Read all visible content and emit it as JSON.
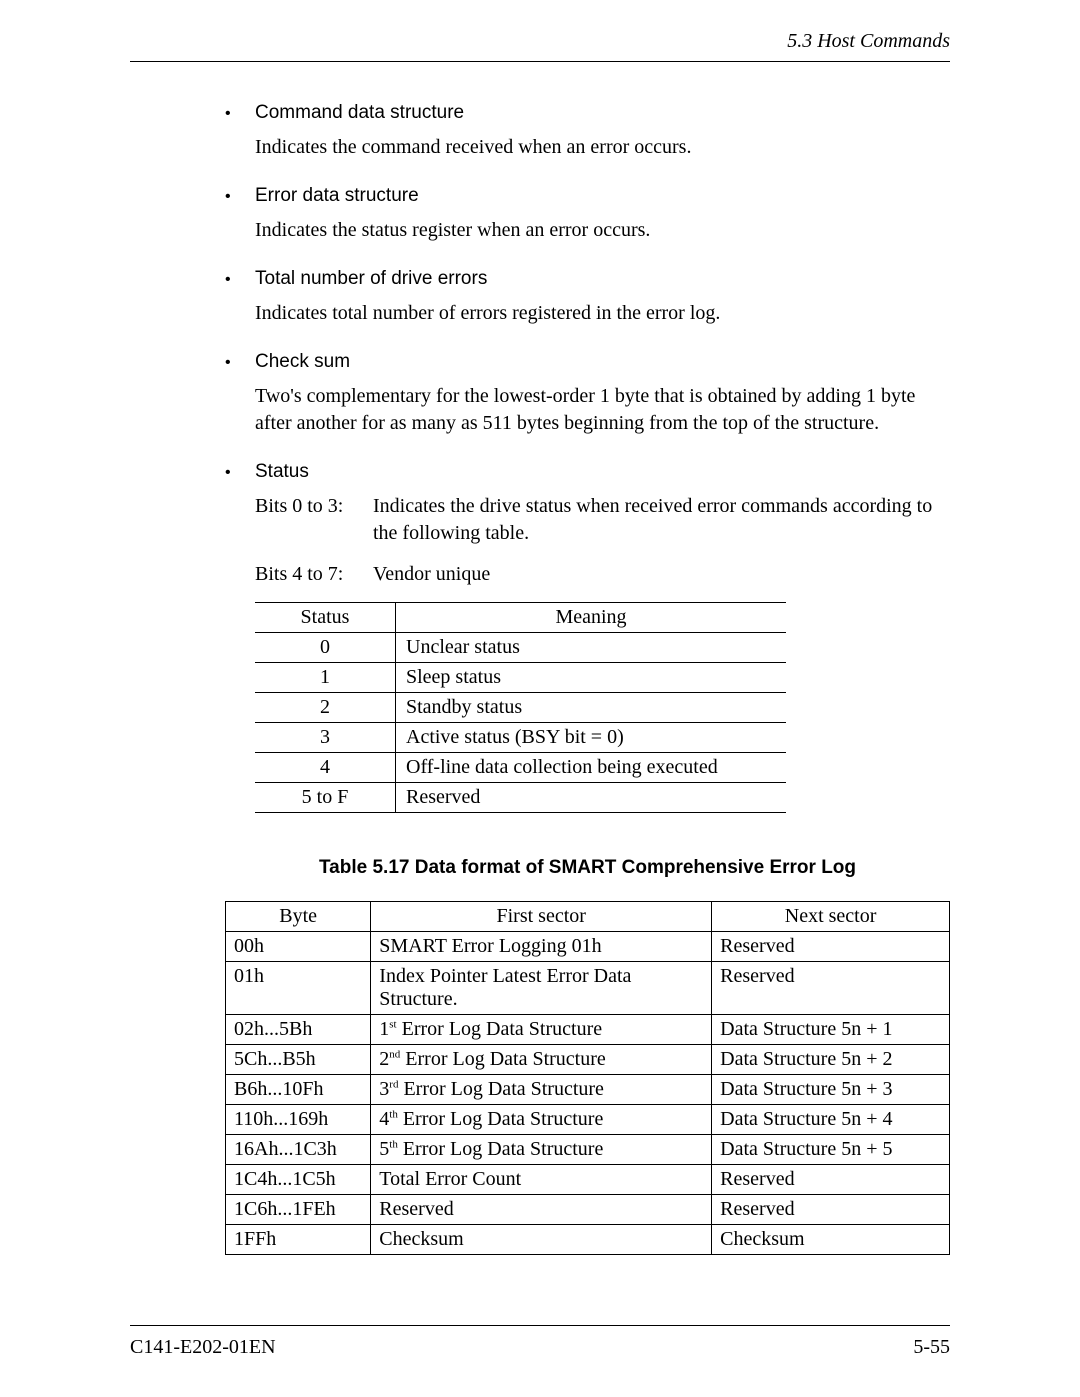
{
  "header": {
    "section": "5.3  Host Commands"
  },
  "bullets": [
    {
      "title": "Command data structure",
      "desc": "Indicates the command received when an error occurs."
    },
    {
      "title": "Error data structure",
      "desc": "Indicates the status register when an error occurs."
    },
    {
      "title": "Total number of drive errors",
      "desc": "Indicates total number of errors registered in the error log."
    },
    {
      "title": "Check sum",
      "desc": "Two's complementary for the lowest-order 1 byte that is obtained by adding 1 byte after another for as many as 511 bytes beginning from the top of the structure."
    },
    {
      "title": "Status"
    }
  ],
  "status_bits": {
    "row0_label": "Bits 0 to 3:",
    "row0_text": "Indicates the drive status when received error commands according to the following table.",
    "row1_label": "Bits 4 to 7:",
    "row1_text": "Vendor unique"
  },
  "status_table": {
    "headers": [
      "Status",
      "Meaning"
    ],
    "rows": [
      [
        "0",
        "Unclear status"
      ],
      [
        "1",
        "Sleep status"
      ],
      [
        "2",
        "Standby status"
      ],
      [
        "3",
        "Active status (BSY bit = 0)"
      ],
      [
        "4",
        "Off-line data collection being executed"
      ],
      [
        "5 to F",
        "Reserved"
      ]
    ]
  },
  "smart_caption": "Table 5.17  Data format of SMART Comprehensive Error Log",
  "smart_table": {
    "headers": [
      "Byte",
      "First sector",
      "Next sector"
    ],
    "rows": [
      {
        "c1": "00h",
        "c2": "SMART Error Logging 01h",
        "c3": "Reserved"
      },
      {
        "c1": "01h",
        "c2": "Index Pointer Latest Error Data Structure.",
        "c3": "Reserved"
      },
      {
        "c1": "02h...5Bh",
        "c2_pre": "1",
        "c2_ord": "st",
        "c2_post": " Error Log Data Structure",
        "c3": "Data Structure 5n + 1"
      },
      {
        "c1": "5Ch...B5h",
        "c2_pre": "2",
        "c2_ord": "nd",
        "c2_post": " Error Log Data Structure",
        "c3": "Data Structure 5n + 2"
      },
      {
        "c1": "B6h...10Fh",
        "c2_pre": "3",
        "c2_ord": "rd",
        "c2_post": " Error Log Data Structure",
        "c3": "Data Structure 5n + 3"
      },
      {
        "c1": "110h...169h",
        "c2_pre": "4",
        "c2_ord": "th",
        "c2_post": " Error Log Data Structure",
        "c3": "Data Structure 5n + 4"
      },
      {
        "c1": "16Ah...1C3h",
        "c2_pre": "5",
        "c2_ord": "th",
        "c2_post": " Error Log Data Structure",
        "c3": "Data Structure 5n + 5"
      },
      {
        "c1": "1C4h...1C5h",
        "c2": "Total Error Count",
        "c3": "Reserved"
      },
      {
        "c1": "1C6h...1FEh",
        "c2": "Reserved",
        "c3": "Reserved"
      },
      {
        "c1": "1FFh",
        "c2": "Checksum",
        "c3": "Checksum"
      }
    ]
  },
  "footer": {
    "left": "C141-E202-01EN",
    "right": "5-55"
  }
}
